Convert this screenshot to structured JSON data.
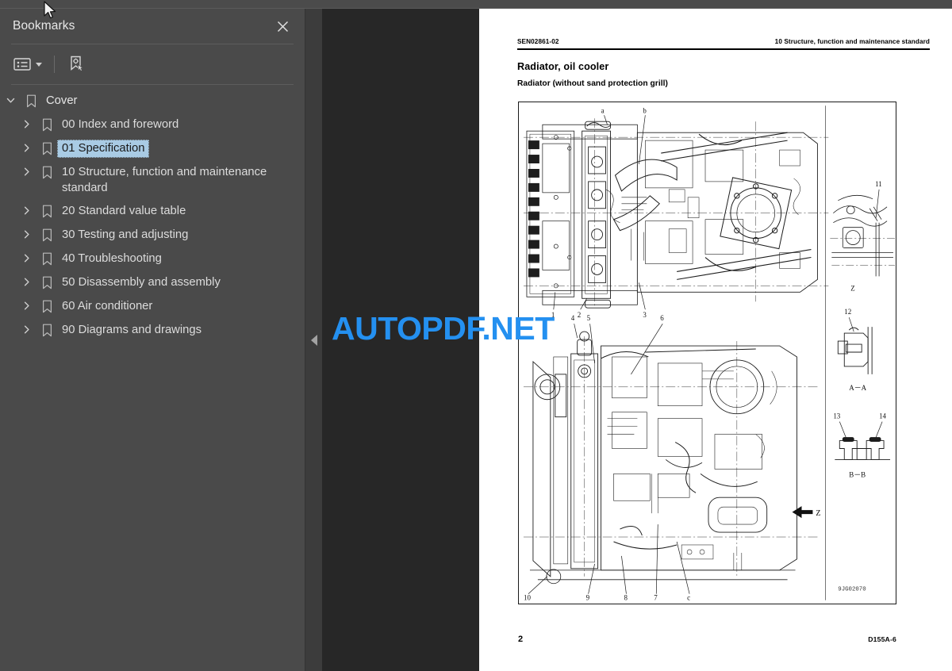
{
  "sidebar": {
    "title": "Bookmarks",
    "close_icon": "close-icon",
    "toolbar": {
      "list_options_icon": "list-options-icon",
      "dropdown_icon": "chevron-down-icon",
      "new_bookmark_icon": "bookmark-settings-icon"
    },
    "tree": [
      {
        "label": "Cover",
        "level": 0,
        "expanded": true,
        "selected": false
      },
      {
        "label": "00 Index and foreword",
        "level": 1,
        "expanded": false,
        "selected": false
      },
      {
        "label": "01 Specification",
        "level": 1,
        "expanded": false,
        "selected": true
      },
      {
        "label": "10 Structure, function and maintenance standard",
        "level": 1,
        "expanded": false,
        "selected": false
      },
      {
        "label": "20 Standard value table",
        "level": 1,
        "expanded": false,
        "selected": false
      },
      {
        "label": "30 Testing and adjusting",
        "level": 1,
        "expanded": false,
        "selected": false
      },
      {
        "label": "40 Troubleshooting",
        "level": 1,
        "expanded": false,
        "selected": false
      },
      {
        "label": "50 Disassembly and assembly",
        "level": 1,
        "expanded": false,
        "selected": false
      },
      {
        "label": "60 Air conditioner",
        "level": 1,
        "expanded": false,
        "selected": false
      },
      {
        "label": "90 Diagrams and drawings",
        "level": 1,
        "expanded": false,
        "selected": false
      }
    ]
  },
  "divider": {
    "collapse_icon": "collapse-left-icon"
  },
  "watermark": {
    "text": "AUTOPDF.NET",
    "color": "#2490f0"
  },
  "document": {
    "header_left": "SEN02861-02",
    "header_right": "10 Structure, function and maintenance standard",
    "title": "Radiator, oil cooler",
    "subtitle": "Radiator (without sand protection grill)",
    "figure": {
      "drawing_id": "9JG02070",
      "callouts_top_view": [
        "a",
        "b",
        "1",
        "2",
        "3"
      ],
      "callouts_bottom_view": [
        "4",
        "5",
        "6",
        "10",
        "9",
        "8",
        "7",
        "c"
      ],
      "detail_views": [
        {
          "name": "Z",
          "callouts": [
            "11"
          ]
        },
        {
          "name": "A－A",
          "callouts": [
            "12"
          ]
        },
        {
          "name": "B－B",
          "callouts": [
            "13",
            "14"
          ]
        }
      ],
      "section_arrow_label": "Z"
    },
    "footer_page": "2",
    "footer_model": "D155A-6"
  },
  "colors": {
    "sidebar_bg": "#4a4a4a",
    "viewer_bg": "#272727",
    "selection": "#a9cbe4",
    "accent": "#2490f0"
  }
}
